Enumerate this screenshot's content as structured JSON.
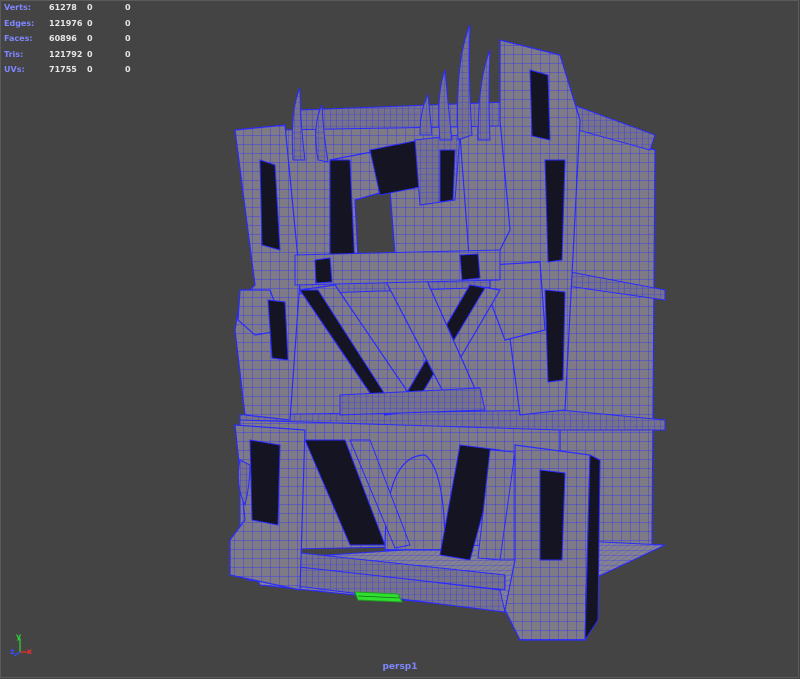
{
  "hud": {
    "rows": [
      {
        "label": "Verts:",
        "value": "61278",
        "c1": "0",
        "c2": "0"
      },
      {
        "label": "Edges:",
        "value": "121976",
        "c1": "0",
        "c2": "0"
      },
      {
        "label": "Faces:",
        "value": "60896",
        "c1": "0",
        "c2": "0"
      },
      {
        "label": "Tris:",
        "value": "121792",
        "c1": "0",
        "c2": "0"
      },
      {
        "label": "UVs:",
        "value": "71755",
        "c1": "0",
        "c2": "0"
      }
    ]
  },
  "camera": {
    "name": "persp1"
  },
  "axes": {
    "y": "y",
    "z": "z",
    "x": "x"
  },
  "colors": {
    "background": "#444444",
    "mesh_fill": "#7e7b87",
    "mesh_shadow": "#141422",
    "wire": "#2a2aff",
    "label_blue": "#7f86ff",
    "axis_x": "#e03030",
    "axis_y": "#30d030",
    "axis_z": "#3050ff",
    "manipulator": "#30e030"
  }
}
